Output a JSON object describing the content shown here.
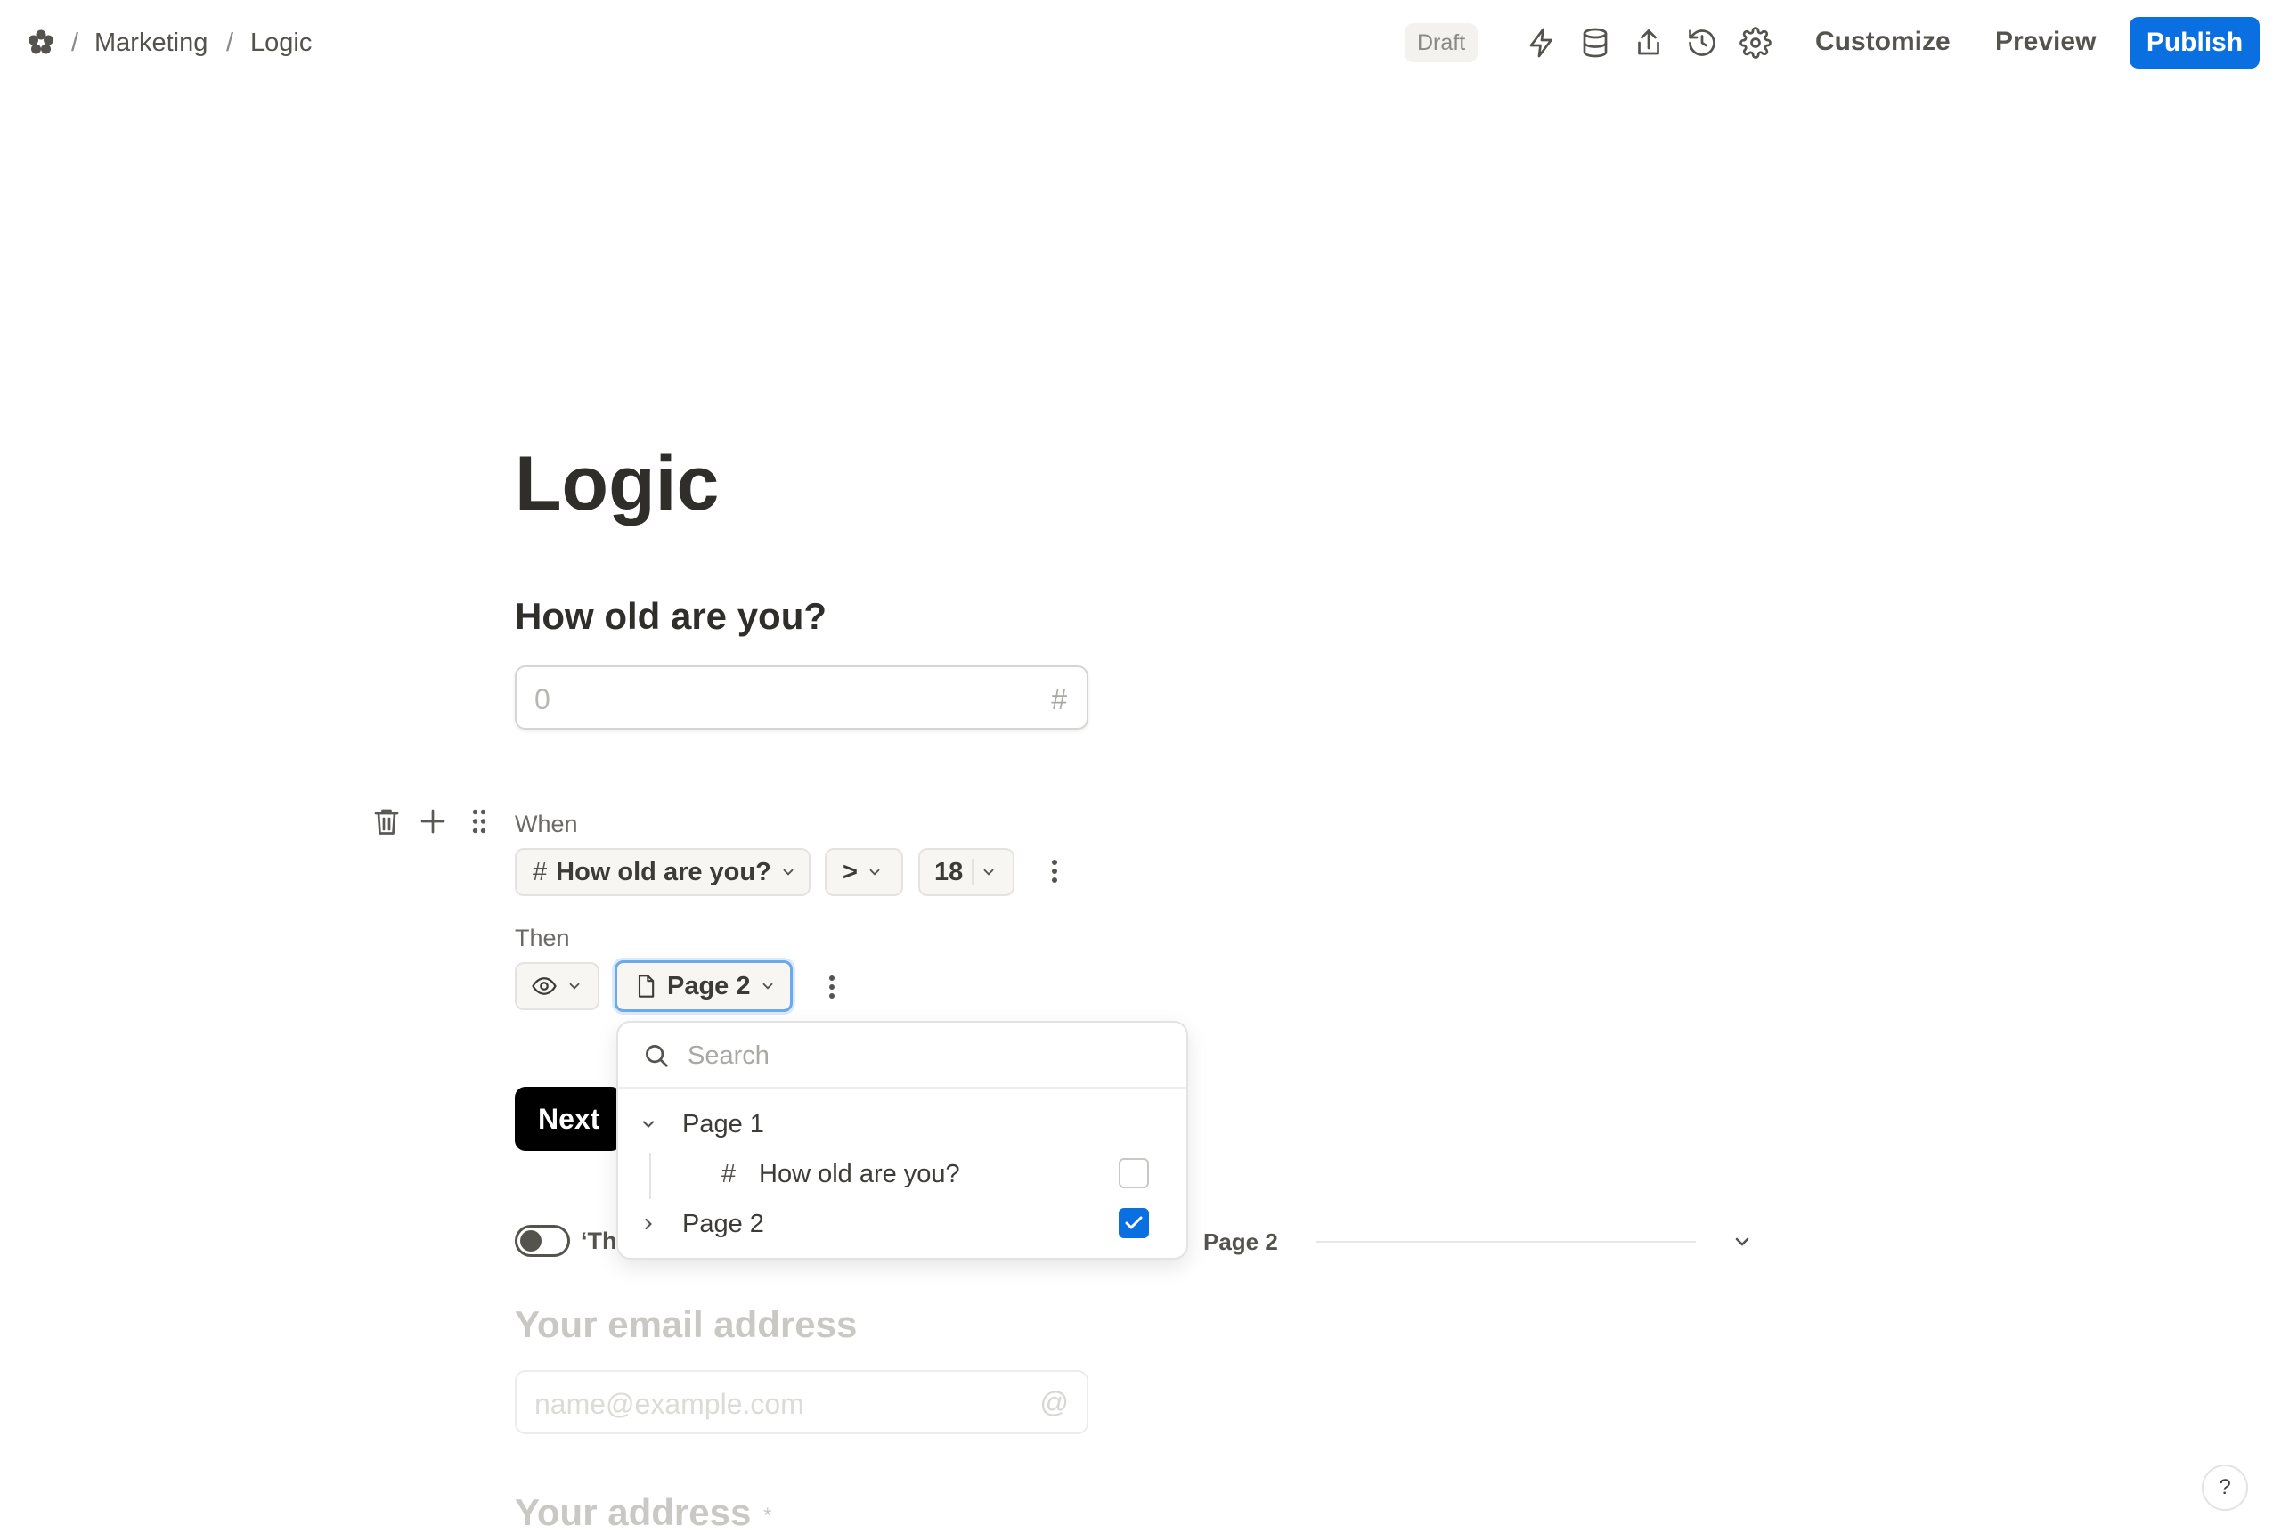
{
  "topbar": {
    "breadcrumb": [
      "Marketing",
      "Logic"
    ],
    "separator": "/",
    "status_badge": "Draft",
    "icons": [
      "lightning-icon",
      "database-icon",
      "share-icon",
      "history-icon",
      "settings-icon"
    ],
    "customize_label": "Customize",
    "preview_label": "Preview",
    "publish_label": "Publish",
    "accent_color": "#0a6fe0"
  },
  "form": {
    "title": "Logic",
    "question": "How old are you?",
    "number_input": {
      "placeholder": "0",
      "suffix": "#"
    }
  },
  "logic_rule": {
    "when_label": "When",
    "condition_field": "How old are you?",
    "operator": ">",
    "value": "18",
    "then_label": "Then",
    "action_icon": "eye-icon",
    "target": "Page 2"
  },
  "dropdown": {
    "search_placeholder": "Search",
    "items": [
      {
        "label": "Page 1",
        "expanded": true,
        "children": [
          {
            "label": "How old are you?",
            "icon": "hash-icon",
            "checked": false
          }
        ]
      },
      {
        "label": "Page 2",
        "expanded": false,
        "checked": true
      }
    ]
  },
  "next_button": "Next",
  "page_break": {
    "toggle_text": "‘Th",
    "page_label": "Page 2"
  },
  "email_question": {
    "title": "Your email address",
    "placeholder": "name@example.com",
    "suffix": "@"
  },
  "address_question": {
    "title": "Your address",
    "required_marker": "*"
  },
  "help_label": "?"
}
